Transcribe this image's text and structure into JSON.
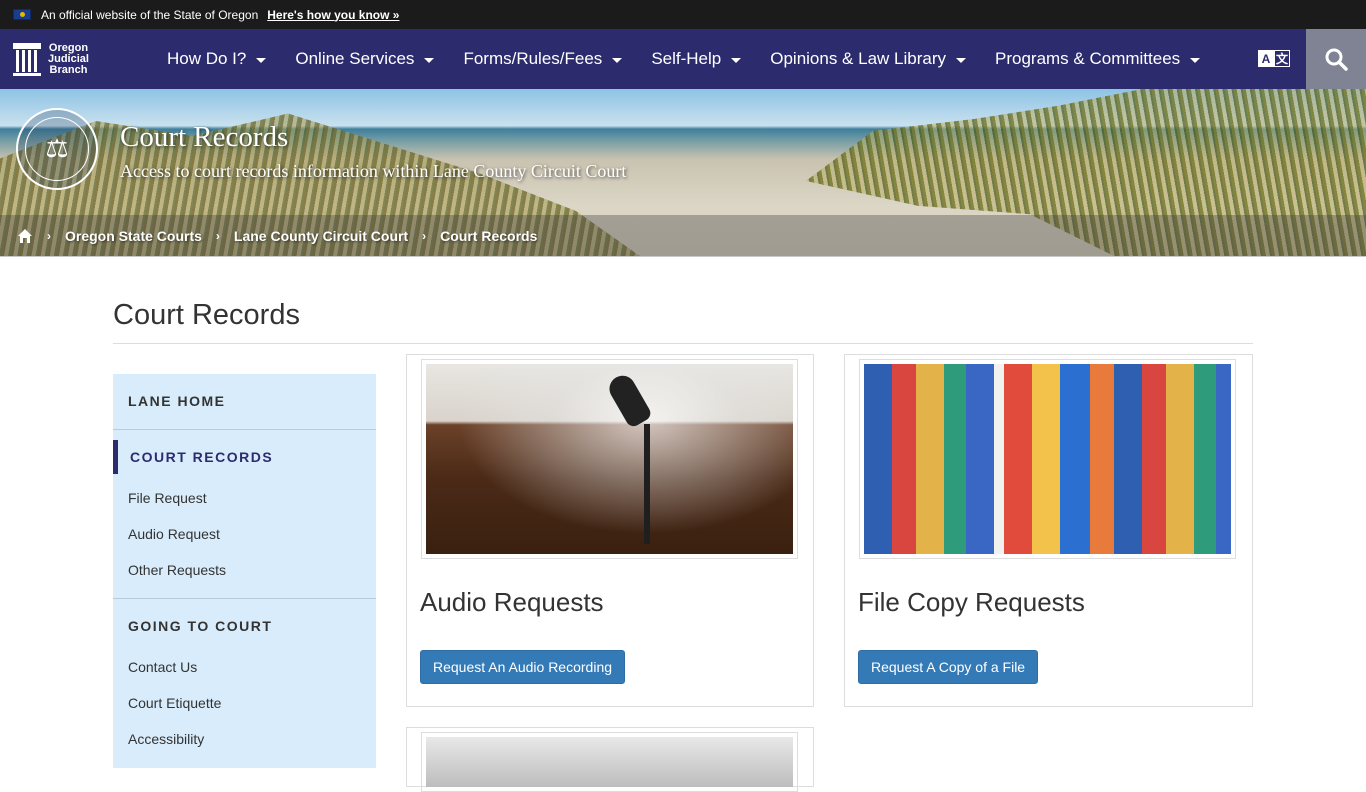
{
  "banner": {
    "text": "An official website of the State of Oregon",
    "link": "Here's how you know »"
  },
  "logo": {
    "line1": "Oregon",
    "line2": "Judicial",
    "line3": "Branch"
  },
  "nav": {
    "items": [
      {
        "label": "How Do I?"
      },
      {
        "label": "Online Services"
      },
      {
        "label": "Forms/Rules/Fees"
      },
      {
        "label": "Self-Help"
      },
      {
        "label": "Opinions & Law Library"
      },
      {
        "label": "Programs & Committees"
      }
    ],
    "translate_a": "A",
    "translate_b": "文"
  },
  "hero": {
    "title": "Court Records",
    "subtitle": "Access to court records information within Lane County Circuit Court"
  },
  "breadcrumb": [
    "Oregon State Courts",
    "Lane County Circuit Court",
    "Court Records"
  ],
  "page": {
    "title": "Court Records"
  },
  "sidebar": {
    "lane_home": "LANE HOME",
    "court_records": "COURT RECORDS",
    "court_records_links": [
      "File Request",
      "Audio Request",
      "Other Requests"
    ],
    "going_to_court": "GOING TO COURT",
    "going_links": [
      "Contact Us",
      "Court Etiquette",
      "Accessibility"
    ]
  },
  "cards": [
    {
      "title": "Audio Requests",
      "button": "Request An Audio Recording"
    },
    {
      "title": "File Copy Requests",
      "button": "Request A Copy of a File"
    }
  ],
  "colors": {
    "nav_bg": "#2c2b6e",
    "sidebar_bg": "#d9ecfb",
    "button": "#337ab7"
  }
}
